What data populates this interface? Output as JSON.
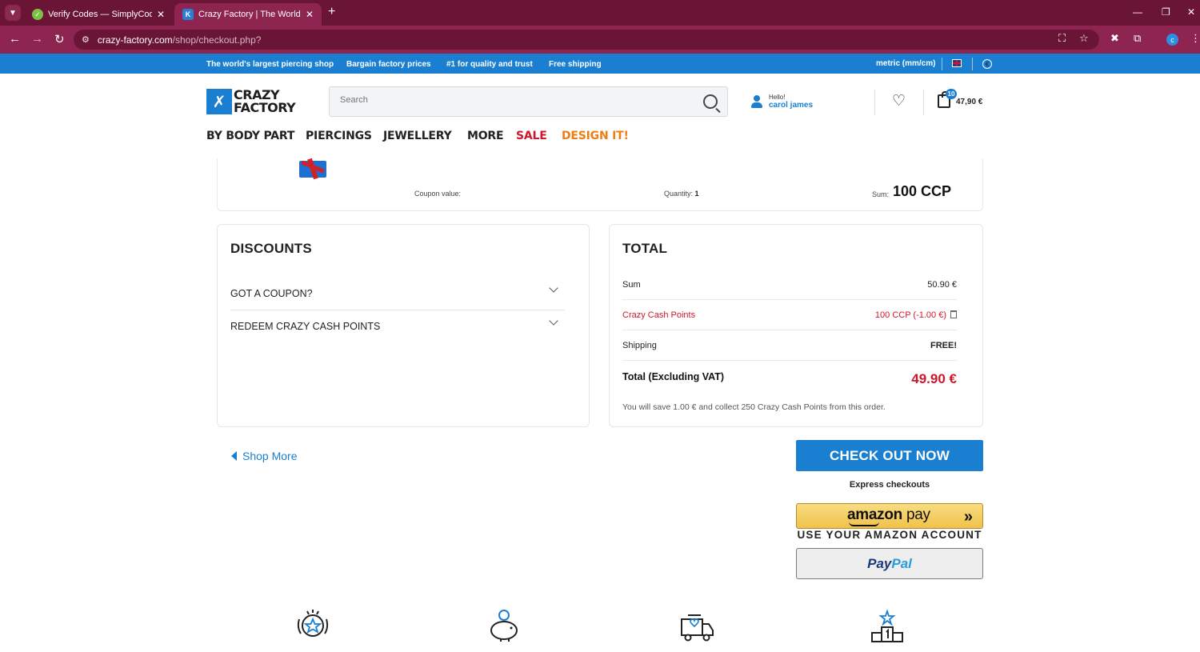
{
  "browser": {
    "tabs": [
      {
        "title": "Verify Codes — SimplyCodes",
        "active": false
      },
      {
        "title": "Crazy Factory | The World's No.",
        "active": true
      }
    ],
    "url_host": "crazy-factory.com",
    "url_path": "/shop/checkout.php?",
    "profile_initial": "c"
  },
  "promo": {
    "items": [
      "The world's largest piercing shop",
      "Bargain factory prices",
      "#1 for quality and trust",
      "Free shipping"
    ],
    "units": "metric (mm/cm)",
    "currency_symbol": "€"
  },
  "header": {
    "logo_line1": "CRAZY",
    "logo_line2": "FACTORY",
    "search_placeholder": "Search",
    "greeting": "Hello!",
    "user_name": "carol james",
    "cart_count": "10",
    "cart_total": "47,90 €"
  },
  "nav": {
    "items": [
      {
        "label": "BY BODY PART",
        "color": "#1d1d1d"
      },
      {
        "label": "PIERCINGS",
        "color": "#1d1d1d"
      },
      {
        "label": "JEWELLERY",
        "color": "#1d1d1d"
      },
      {
        "label": "MORE",
        "color": "#1d1d1d"
      },
      {
        "label": "SALE",
        "color": "#d0162b"
      },
      {
        "label": "DESIGN IT!",
        "color": "#ee7d12"
      }
    ]
  },
  "item": {
    "coupon_value_label": "Coupon value:",
    "quantity_label": "Quantity:",
    "quantity": "1",
    "sum_label": "Sum:",
    "sum_value": "100 CCP"
  },
  "discounts": {
    "title": "DISCOUNTS",
    "coupon_label": "GOT A COUPON?",
    "redeem_label": "REDEEM CRAZY CASH POINTS"
  },
  "total": {
    "title": "TOTAL",
    "sum_label": "Sum",
    "sum_value": "50.90 €",
    "ccp_label": "Crazy Cash Points",
    "ccp_value": "100 CCP (-1.00 €)",
    "shipping_label": "Shipping",
    "shipping_value": "FREE!",
    "grand_label": "Total (Excluding VAT)",
    "grand_value": "49.90 €",
    "note": "You will save 1.00 € and collect 250 Crazy Cash Points from this order."
  },
  "actions": {
    "shop_more": "Shop More",
    "checkout": "CHECK OUT NOW",
    "express": "Express checkouts",
    "amazon_brand": "amazon",
    "amazon_pay": "pay",
    "amazon_sub": "USE YOUR AMAZON ACCOUNT",
    "paypal_1": "Pay",
    "paypal_2": "Pal"
  },
  "colors": {
    "brand_blue": "#1a7fd1",
    "accent_red": "#d0162b",
    "design_orange": "#ee7d12",
    "chrome": "#6b1536"
  }
}
